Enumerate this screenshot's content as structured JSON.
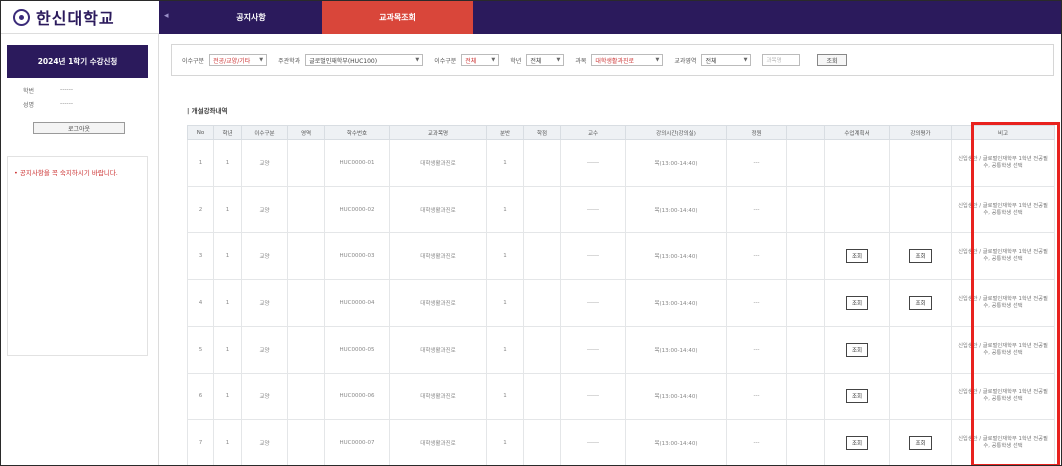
{
  "brand": {
    "logo_text": "한신대학교",
    "seal_icon": "university-seal-icon"
  },
  "header": {
    "menu_toggle": "◂",
    "tabs": [
      {
        "label": "공지사항",
        "active": false
      },
      {
        "label": "교과목조회",
        "active": true
      }
    ]
  },
  "sidebar": {
    "semester_title": "2024년 1학기 수강신청",
    "info": [
      {
        "label": "학번",
        "value": "------"
      },
      {
        "label": "성명",
        "value": "------"
      }
    ],
    "logout_label": "로그아웃",
    "notice": "• 공지사항을 꼭 숙지하시기 바랍니다."
  },
  "filters": {
    "items": [
      {
        "label": "이수구분",
        "value": "전공/교양/기타",
        "red": true
      },
      {
        "label": "주관학과",
        "value": "글로벌인재학부(HUC100)",
        "red": false
      },
      {
        "label": "이수구분",
        "value": "전체",
        "red": true
      },
      {
        "label": "학년",
        "value": "전체",
        "red": false
      },
      {
        "label": "과목",
        "value": "대학생활과진로",
        "red": true
      },
      {
        "label": "교과영역",
        "value": "전체",
        "red": false
      }
    ],
    "search_placeholder": "과목명",
    "search_button": "조회"
  },
  "results": {
    "section_title": "| 개설강좌내역",
    "columns": [
      "No",
      "학년",
      "이수구분",
      "영역",
      "학수번호",
      "교과목명",
      "분반",
      "학점",
      "교수",
      "강의시간(강의실)",
      "정원",
      "수업계획서",
      "강의평가",
      "비고"
    ],
    "rows": [
      {
        "no": "1",
        "year": "1",
        "type": "교양",
        "area": "",
        "code": "HUC0000-01",
        "name": "대학생활과진로",
        "section": "1",
        "credit": "",
        "professor": "------",
        "time": "목(13:00-14:40)",
        "capacity": "---",
        "enroll": "",
        "syllabus": "",
        "evaluation": "",
        "remark": "신입생만 / 글로벌인재학부 1학년 전공필수, 공통학생 선택"
      },
      {
        "no": "2",
        "year": "1",
        "type": "교양",
        "area": "",
        "code": "HUC0000-02",
        "name": "대학생활과진로",
        "section": "1",
        "credit": "",
        "professor": "------",
        "time": "목(13:00-14:40)",
        "capacity": "---",
        "enroll": "",
        "syllabus": "",
        "evaluation": "",
        "remark": "신입생만 / 글로벌인재학부 1학년 전공필수, 공통학생 선택"
      },
      {
        "no": "3",
        "year": "1",
        "type": "교양",
        "area": "",
        "code": "HUC0000-03",
        "name": "대학생활과진로",
        "section": "1",
        "credit": "",
        "professor": "------",
        "time": "목(13:00-14:40)",
        "capacity": "---",
        "enroll": "",
        "syllabus": "조회",
        "evaluation": "조회",
        "remark": "신입생만 / 글로벌인재학부 1학년 전공필수, 공통학생 선택"
      },
      {
        "no": "4",
        "year": "1",
        "type": "교양",
        "area": "",
        "code": "HUC0000-04",
        "name": "대학생활과진로",
        "section": "1",
        "credit": "",
        "professor": "------",
        "time": "목(13:00-14:40)",
        "capacity": "---",
        "enroll": "",
        "syllabus": "조회",
        "evaluation": "조회",
        "remark": "신입생만 / 글로벌인재학부 1학년 전공필수, 공통학생 선택"
      },
      {
        "no": "5",
        "year": "1",
        "type": "교양",
        "area": "",
        "code": "HUC0000-05",
        "name": "대학생활과진로",
        "section": "1",
        "credit": "",
        "professor": "------",
        "time": "목(13:00-14:40)",
        "capacity": "---",
        "enroll": "",
        "syllabus": "조회",
        "evaluation": "",
        "remark": "신입생만 / 글로벌인재학부 1학년 전공필수, 공통학생 선택"
      },
      {
        "no": "6",
        "year": "1",
        "type": "교양",
        "area": "",
        "code": "HUC0000-06",
        "name": "대학생활과진로",
        "section": "1",
        "credit": "",
        "professor": "------",
        "time": "목(13:00-14:40)",
        "capacity": "---",
        "enroll": "",
        "syllabus": "조회",
        "evaluation": "",
        "remark": "신입생만 / 글로벌인재학부 1학년 전공필수, 공통학생 선택"
      },
      {
        "no": "7",
        "year": "1",
        "type": "교양",
        "area": "",
        "code": "HUC0000-07",
        "name": "대학생활과진로",
        "section": "1",
        "credit": "",
        "professor": "------",
        "time": "목(13:00-14:40)",
        "capacity": "---",
        "enroll": "",
        "syllabus": "조회",
        "evaluation": "조회",
        "remark": "신입생만 / 글로벌인재학부 1학년 전공필수, 공통학생 선택"
      }
    ]
  },
  "colors": {
    "navy": "#2b1a5c",
    "accent_red": "#d9463a",
    "highlight": "#e8221e"
  }
}
